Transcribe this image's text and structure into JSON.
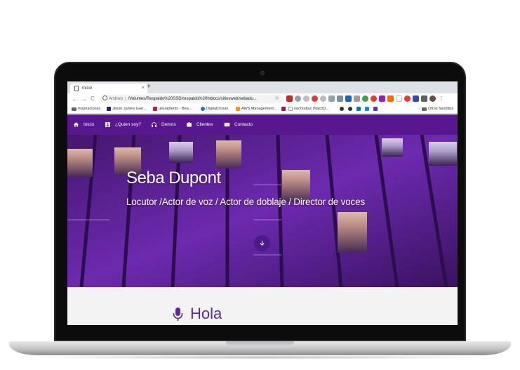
{
  "browser": {
    "tab_title": "Inicio",
    "tab_close": "×",
    "new_tab": "+",
    "nav_back": "←",
    "nav_forward": "→",
    "nav_reload": "C",
    "url_label": "Archivo",
    "url": "/Volumes/Respaldo%20SSD/respaldo%20htdocs/sitiosweb/sebadu...",
    "bookmark_star": "☆",
    "bookmarks": [
      {
        "label": "Inspiraciones",
        "icon": "folder-icon"
      },
      {
        "label": "Jesse James Garr...",
        "icon": "bookmark-icon"
      },
      {
        "label": "uiGradients - Bea...",
        "icon": "bookmark-icon"
      },
      {
        "label": "DigitalOcean",
        "icon": "bookmark-icon"
      },
      {
        "label": "AWS Management...",
        "icon": "bookmark-icon"
      },
      {
        "label": "nachodiaz (NachD...",
        "icon": "github-icon"
      }
    ],
    "other_bookmarks": "Otros favoritos"
  },
  "site": {
    "nav": [
      {
        "label": "Inicio",
        "icon": "home-icon"
      },
      {
        "label": "¿Quien soy?",
        "icon": "contact-card-icon"
      },
      {
        "label": "Demos",
        "icon": "headphones-icon"
      },
      {
        "label": "Clientes",
        "icon": "briefcase-icon"
      },
      {
        "label": "Contacto",
        "icon": "envelope-icon"
      }
    ],
    "hero": {
      "title": "Seba Dupont",
      "subtitle": "Locutor /Actor de voz / Actor de doblaje / Director de voces",
      "scroll_icon": "arrow-down-icon"
    },
    "section": {
      "icon": "microphone-icon",
      "heading": "Hola"
    }
  },
  "colors": {
    "nav_bg": "#58178f",
    "accent": "#5a2a9e",
    "hero_tint": "#7b2fd0"
  }
}
